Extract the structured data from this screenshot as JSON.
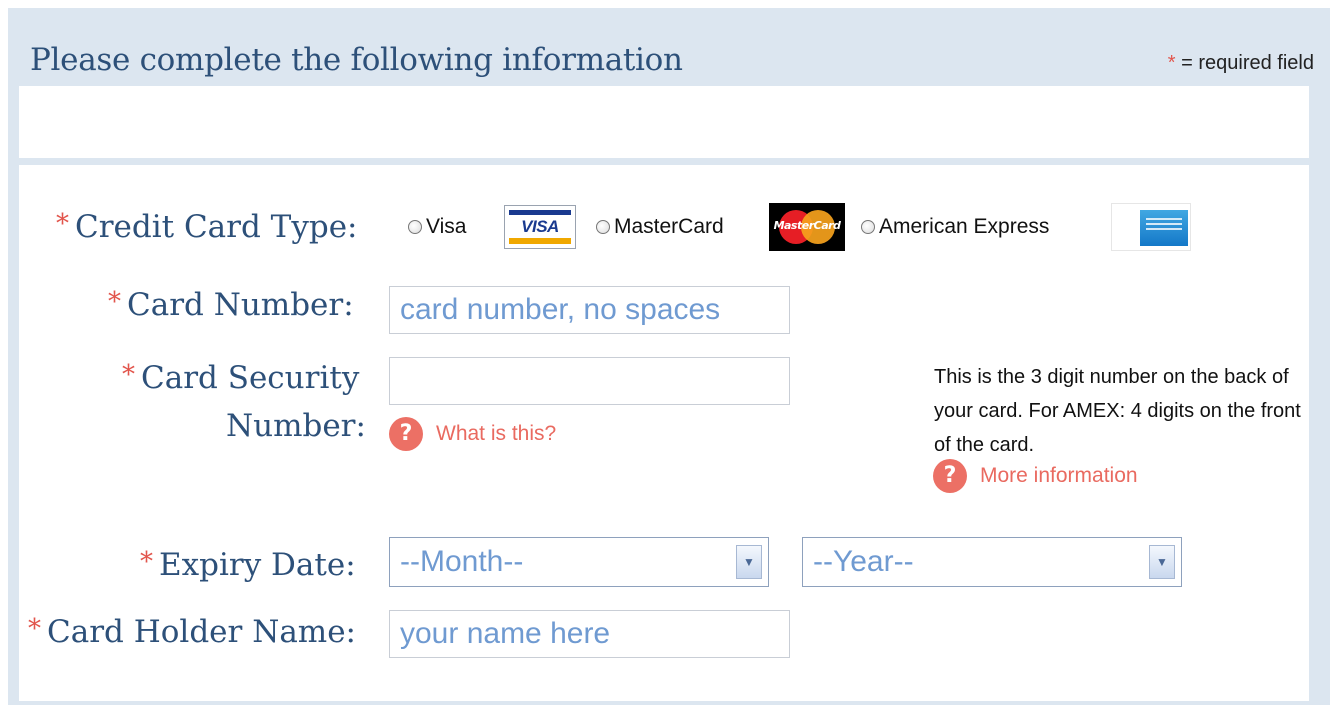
{
  "header": {
    "title": "Please complete the following information",
    "required_star": "*",
    "required_note": "= required field"
  },
  "form": {
    "card_type": {
      "label": "Credit Card Type:",
      "options": [
        {
          "label": "Visa",
          "logo_text": "VISA"
        },
        {
          "label": "MasterCard",
          "logo_text": "MasterCard"
        },
        {
          "label": "American Express"
        }
      ]
    },
    "card_number": {
      "label": "Card Number:",
      "placeholder": "card number, no spaces"
    },
    "security_number": {
      "label_line1": "Card Security",
      "label_line2": "Number:",
      "value": "",
      "help_link": "What is this?",
      "help_icon": "?"
    },
    "info": {
      "text": "This is the 3 digit number on the back of your card. For AMEX: 4 digits on the front of the card.",
      "more_link": "More information"
    },
    "expiry": {
      "label": "Expiry Date:",
      "month_selected": "--Month--",
      "year_selected": "--Year--"
    },
    "holder": {
      "label": "Card Holder Name:",
      "placeholder": "your name here"
    }
  },
  "colors": {
    "label": "#2d5079",
    "required": "#e2554c",
    "placeholder": "#6f9ad1",
    "link": "#e96a60",
    "panel": "#dce6f0"
  }
}
